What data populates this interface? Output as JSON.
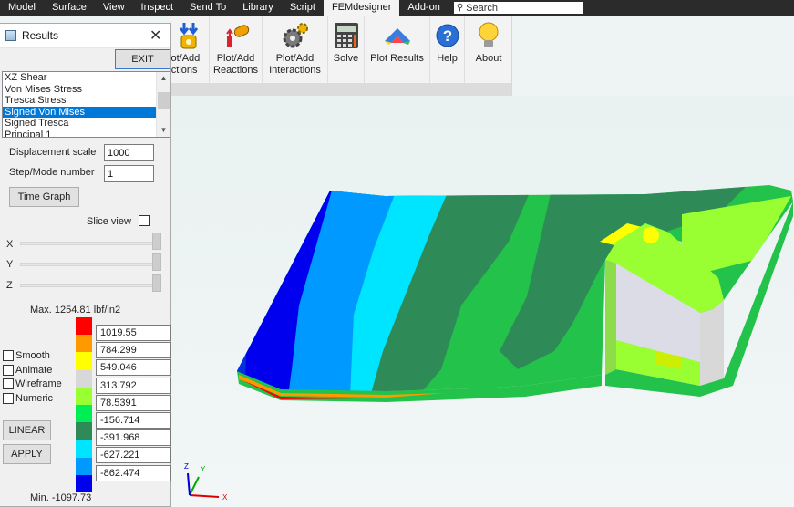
{
  "menu": {
    "items": [
      "Model",
      "Surface",
      "View",
      "Inspect",
      "Send To",
      "Library",
      "Script",
      "FEMdesigner",
      "Add-on"
    ],
    "active": "FEMdesigner",
    "search_placeholder": "Search"
  },
  "ribbon": {
    "actions_label": "Plot/Add\nActions",
    "reactions_label": "Plot/Add\nReactions",
    "interactions_label": "Plot/Add\nInteractions",
    "solve_label": "Solve",
    "plot_results_label": "Plot Results",
    "help_label": "Help",
    "about_label": "About"
  },
  "results_panel": {
    "title": "Results",
    "exit_label": "EXIT",
    "result_types": [
      "XZ Shear",
      "Von Mises Stress",
      "Tresca Stress",
      "Signed Von Mises",
      "Signed Tresca",
      "Principal 1"
    ],
    "selected_index": 3,
    "displacement_scale_label": "Displacement scale",
    "displacement_scale_value": "1000",
    "step_mode_label": "Step/Mode number",
    "step_mode_value": "1",
    "time_graph_label": "Time Graph",
    "slice_view_label": "Slice view",
    "axis_x": "X",
    "axis_y": "Y",
    "axis_z": "Z",
    "max_label": "Max. 1254.81 lbf/in2",
    "min_label": "Min. -1097.73",
    "smooth_label": "Smooth",
    "animate_label": "Animate",
    "wireframe_label": "Wireframe",
    "numeric_label": "Numeric",
    "linear_label": "LINEAR",
    "apply_label": "APPLY",
    "legend_values": [
      "1019.55",
      "784.299",
      "549.046",
      "313.792",
      "78.5391",
      "-156.714",
      "-391.968",
      "-627.221",
      "-862.474"
    ],
    "legend_colors": [
      "#ff0000",
      "#ff9900",
      "#ffff00",
      "#d8d8d8",
      "#99ff33",
      "#00ee55",
      "#2e8b57",
      "#00e5ff",
      "#0099ff",
      "#0000ee"
    ]
  },
  "viewport": {
    "triad_x": "X",
    "triad_y": "Y",
    "triad_z": "Z"
  }
}
